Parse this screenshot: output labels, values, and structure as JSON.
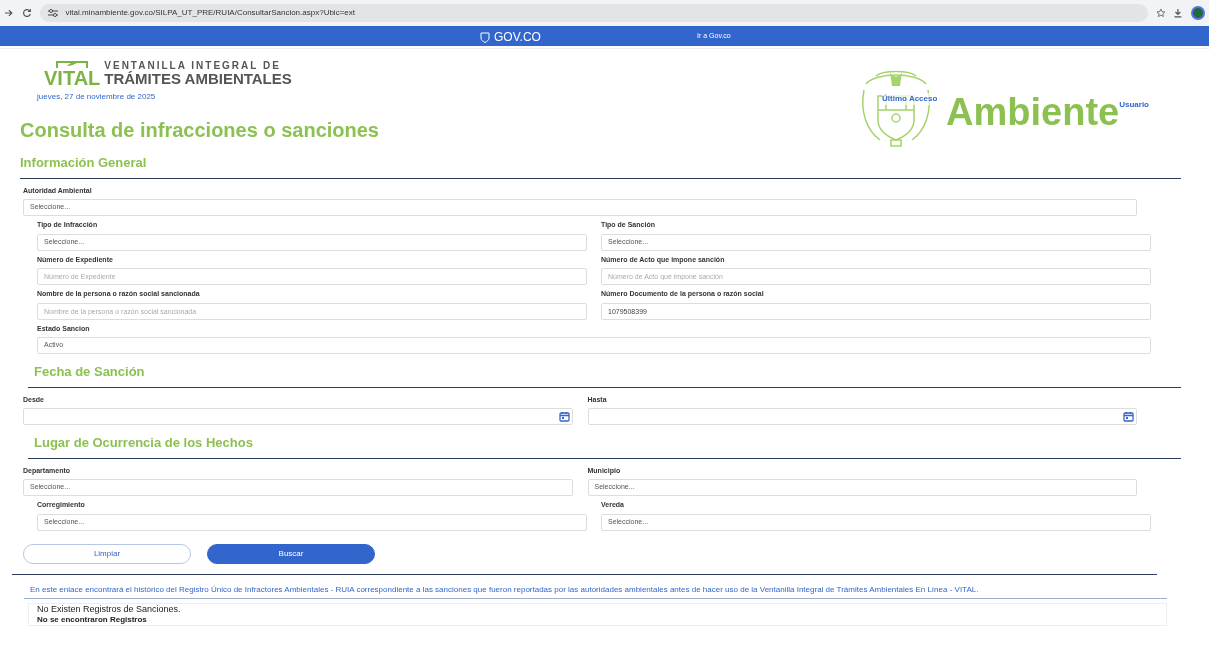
{
  "browser": {
    "url": "vital.minambiente.gov.co/SILPA_UT_PRE/RUIA/ConsultarSancion.aspx?Ubic=ext"
  },
  "gov_bar": {
    "logo": "GOV.CO",
    "link": "Ir a Gov.co"
  },
  "header": {
    "logo_top": "VENTANILLA INTEGRAL DE",
    "logo_brand": "VITAL",
    "logo_bottom": "TRÁMITES AMBIENTALES",
    "date": "jueves, 27 de noviembre de 2025",
    "last_access": "Último Acceso",
    "ministry": "Ambiente",
    "user": "Usuario"
  },
  "page_title": "Consulta de infracciones o sanciones",
  "sections": [
    {
      "title": "Información General",
      "rows": [
        {
          "kind": "wide",
          "fields": [
            {
              "label": "Autoridad Ambiental",
              "kind": "select",
              "value": "Seleccione..."
            }
          ]
        },
        {
          "kind": "inset",
          "fields": [
            {
              "label": "Tipo de Infracción",
              "kind": "select",
              "value": "Seleccione..."
            },
            {
              "label": "Tipo de Sanción",
              "kind": "select",
              "value": "Seleccione..."
            }
          ]
        },
        {
          "kind": "inset",
          "fields": [
            {
              "label": "Número de Expediente",
              "kind": "input",
              "placeholder": "Número de Expediente"
            },
            {
              "label": "Número de Acto que impone sanción",
              "kind": "input",
              "placeholder": "Número de Acto que impone sanción"
            }
          ]
        },
        {
          "kind": "inset",
          "fields": [
            {
              "label": "Nombre de la persona o razón social sancionada",
              "kind": "input",
              "placeholder": "Nombre de la persona o razón social sancionada"
            },
            {
              "label": "Número Documento de la persona o razón social",
              "kind": "input",
              "value": "1079508399"
            }
          ]
        },
        {
          "kind": "inset",
          "fields": [
            {
              "label": "Estado Sancion",
              "kind": "select",
              "value": "Activo"
            }
          ]
        }
      ]
    },
    {
      "title": "Fecha de Sanción",
      "rows": [
        {
          "kind": "wide",
          "fields": [
            {
              "label": "Desde",
              "kind": "date"
            },
            {
              "label": "Hasta",
              "kind": "date"
            }
          ]
        }
      ]
    },
    {
      "title": "Lugar de Ocurrencia de los Hechos",
      "rows": [
        {
          "kind": "wide",
          "fields": [
            {
              "label": "Departamento",
              "kind": "select",
              "value": "Seleccione..."
            },
            {
              "label": "Municipio",
              "kind": "select",
              "value": "Seleccione..."
            }
          ]
        },
        {
          "kind": "inset",
          "fields": [
            {
              "label": "Corregimiento",
              "kind": "select",
              "value": "Seleccione..."
            },
            {
              "label": "Vereda",
              "kind": "select",
              "value": "Seleccione..."
            }
          ]
        }
      ]
    }
  ],
  "buttons": [
    {
      "label": "Limpiar",
      "kind": "secondary"
    },
    {
      "label": "Buscar",
      "kind": "primary"
    }
  ],
  "history_link": "En este enlace encontrará el histórico del Registro Único de Infractores Ambientales - RUIA correspondiente a las sanciones que fueron reportadas por las autoridades ambientales antes de hacer uso de la Ventanilla Integral de Trámites Ambientales En Línea - VITAL.",
  "results": {
    "message": "No Existen Registros de Sanciones.",
    "note": "No se encontraron Registros"
  }
}
